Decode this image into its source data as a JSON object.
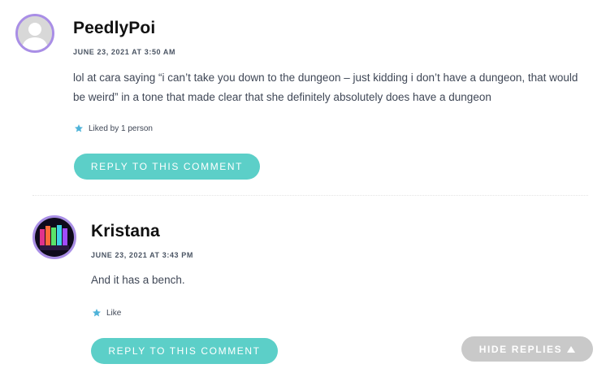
{
  "comments": [
    {
      "author": "PeedlyPoi",
      "date": "JUNE 23, 2021 AT 3:50 AM",
      "text": "lol at cara saying “i can’t take you down to the dungeon – just kidding i don’t have a dungeon, that would be weird” in a tone that made clear that she definitely absolutely does have a dungeon",
      "like_text": "Liked by 1 person",
      "reply_label": "REPLY TO THIS COMMENT",
      "avatar": "default-user-icon"
    },
    {
      "author": "Kristana",
      "date": "JUNE 23, 2021 AT 3:43 PM",
      "text": "And it has a bench.",
      "like_text": "Like",
      "reply_label": "REPLY TO THIS COMMENT",
      "avatar": "colorful-lights-photo"
    }
  ],
  "hide_replies_label": "HIDE REPLIES",
  "colors": {
    "accent": "#5ccfc8",
    "avatar_border": "#a98ee6",
    "star": "#4fb3d9",
    "hide_button": "#c9c9c9"
  }
}
